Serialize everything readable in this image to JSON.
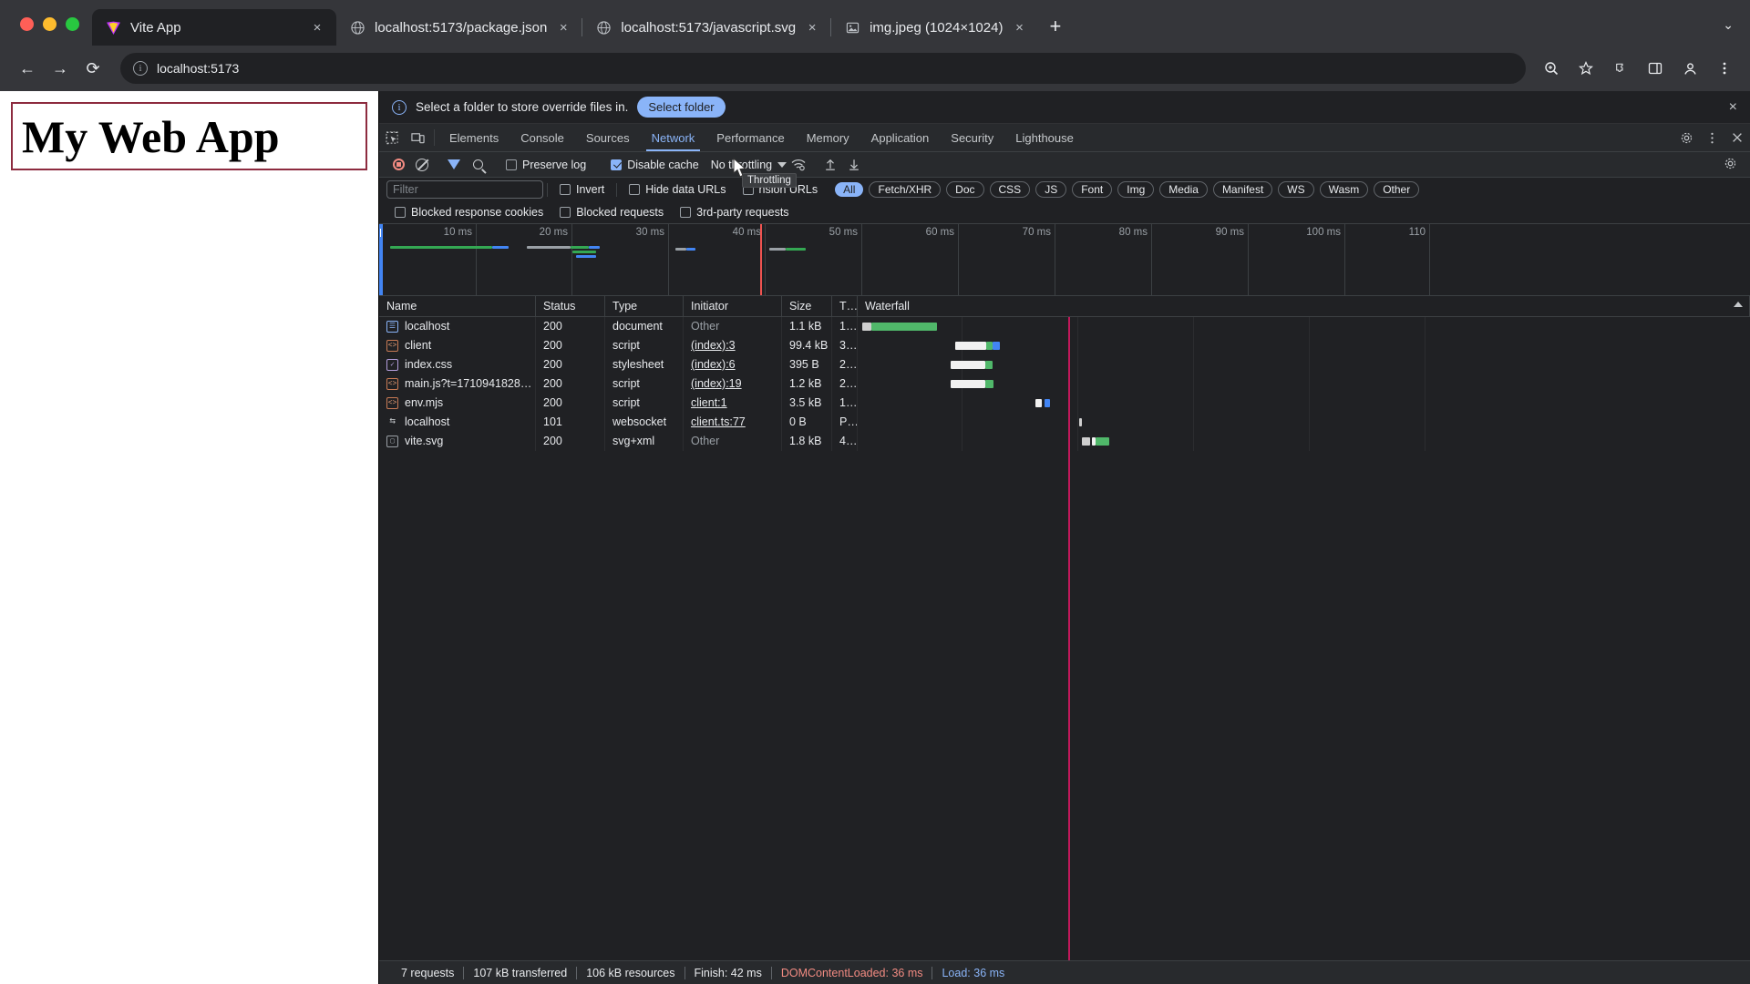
{
  "browser": {
    "tabs": [
      {
        "title": "Vite App",
        "favicon": "vite-icon",
        "active": true
      },
      {
        "title": "localhost:5173/package.json",
        "favicon": "globe-icon",
        "active": false
      },
      {
        "title": "localhost:5173/javascript.svg",
        "favicon": "globe-icon",
        "active": false
      },
      {
        "title": "img.jpeg (1024×1024)",
        "favicon": "image-icon",
        "active": false
      }
    ],
    "close_label": "×",
    "new_tab_label": "+",
    "tablist_chevron": "⌄",
    "nav": {
      "back": "←",
      "forward": "→",
      "reload": "⟳"
    },
    "omnibox": {
      "value": "localhost:5173",
      "info_icon": "i"
    },
    "toolbar_icons": [
      "zoom-icon",
      "bookmark-star-icon",
      "extensions-icon",
      "devtools-panel-icon",
      "profile-icon",
      "menu-icon"
    ]
  },
  "page": {
    "heading": "My Web App"
  },
  "devtools": {
    "infobar": {
      "message": "Select a folder to store override files in.",
      "button": "Select folder",
      "close": "×",
      "info_icon": "i"
    },
    "panel_tabs": [
      {
        "label": "Elements",
        "active": false
      },
      {
        "label": "Console",
        "active": false
      },
      {
        "label": "Sources",
        "active": false
      },
      {
        "label": "Network",
        "active": true
      },
      {
        "label": "Performance",
        "active": false
      },
      {
        "label": "Memory",
        "active": false
      },
      {
        "label": "Application",
        "active": false
      },
      {
        "label": "Security",
        "active": false
      },
      {
        "label": "Lighthouse",
        "active": false
      }
    ],
    "network_toolbar": {
      "record_title": "record-button",
      "clear_title": "clear-button",
      "filter_title": "filter-button",
      "search_title": "search-button",
      "preserve_log": {
        "label": "Preserve log",
        "checked": false
      },
      "disable_cache": {
        "label": "Disable cache",
        "checked": true
      },
      "throttling": {
        "value": "No throttling"
      },
      "tooltip": "Throttling"
    },
    "filter_bar": {
      "filter_placeholder": "Filter",
      "filter_value": "",
      "invert": {
        "label": "Invert",
        "checked": false
      },
      "hide_data_urls": {
        "label": "Hide data URLs",
        "checked": false
      },
      "hide_extension_urls": {
        "label": "nsion URLs",
        "checked": false
      },
      "types": [
        {
          "label": "All",
          "selected": true
        },
        {
          "label": "Fetch/XHR",
          "selected": false
        },
        {
          "label": "Doc",
          "selected": false
        },
        {
          "label": "CSS",
          "selected": false
        },
        {
          "label": "JS",
          "selected": false
        },
        {
          "label": "Font",
          "selected": false
        },
        {
          "label": "Img",
          "selected": false
        },
        {
          "label": "Media",
          "selected": false
        },
        {
          "label": "Manifest",
          "selected": false
        },
        {
          "label": "WS",
          "selected": false
        },
        {
          "label": "Wasm",
          "selected": false
        },
        {
          "label": "Other",
          "selected": false
        }
      ]
    },
    "blocked_bar": [
      {
        "label": "Blocked response cookies",
        "checked": false
      },
      {
        "label": "Blocked requests",
        "checked": false
      },
      {
        "label": "3rd-party requests",
        "checked": false
      }
    ],
    "overview": {
      "ticks": [
        "10 ms",
        "20 ms",
        "30 ms",
        "40 ms",
        "50 ms",
        "60 ms",
        "70 ms",
        "80 ms",
        "90 ms",
        "100 ms",
        "110"
      ]
    },
    "table": {
      "columns": [
        "Name",
        "Status",
        "Type",
        "Initiator",
        "Size",
        "T…",
        "Waterfall"
      ],
      "rows": [
        {
          "name": "localhost",
          "icon": "document-icon",
          "status": "200",
          "type": "document",
          "initiator": "Other",
          "initiator_link": false,
          "size": "1.1 kB",
          "time": "1…"
        },
        {
          "name": "client",
          "icon": "script-icon",
          "status": "200",
          "type": "script",
          "initiator": "(index):3",
          "initiator_link": true,
          "size": "99.4 kB",
          "time": "3…"
        },
        {
          "name": "index.css",
          "icon": "stylesheet-icon",
          "status": "200",
          "type": "stylesheet",
          "initiator": "(index):6",
          "initiator_link": true,
          "size": "395 B",
          "time": "2…"
        },
        {
          "name": "main.js?t=1710941828…",
          "icon": "script-icon",
          "status": "200",
          "type": "script",
          "initiator": "(index):19",
          "initiator_link": true,
          "size": "1.2 kB",
          "time": "2…"
        },
        {
          "name": "env.mjs",
          "icon": "script-icon",
          "status": "200",
          "type": "script",
          "initiator": "client:1",
          "initiator_link": true,
          "size": "3.5 kB",
          "time": "1…"
        },
        {
          "name": "localhost",
          "icon": "websocket-icon",
          "status": "101",
          "type": "websocket",
          "initiator": "client.ts:77",
          "initiator_link": true,
          "size": "0 B",
          "time": "P…"
        },
        {
          "name": "vite.svg",
          "icon": "image-icon",
          "status": "200",
          "type": "svg+xml",
          "initiator": "Other",
          "initiator_link": false,
          "size": "1.8 kB",
          "time": "4…"
        }
      ]
    },
    "status_bar": {
      "requests": "7 requests",
      "transferred": "107 kB transferred",
      "resources": "106 kB resources",
      "finish": "Finish: 42 ms",
      "dcl": "DOMContentLoaded: 36 ms",
      "load": "Load: 36 ms"
    }
  },
  "colors": {
    "accent": "#8ab4f8",
    "dcl": "#f28b82",
    "load": "#8ab4f8",
    "bg": "#202124",
    "heading_border": "#8d2b3f"
  }
}
